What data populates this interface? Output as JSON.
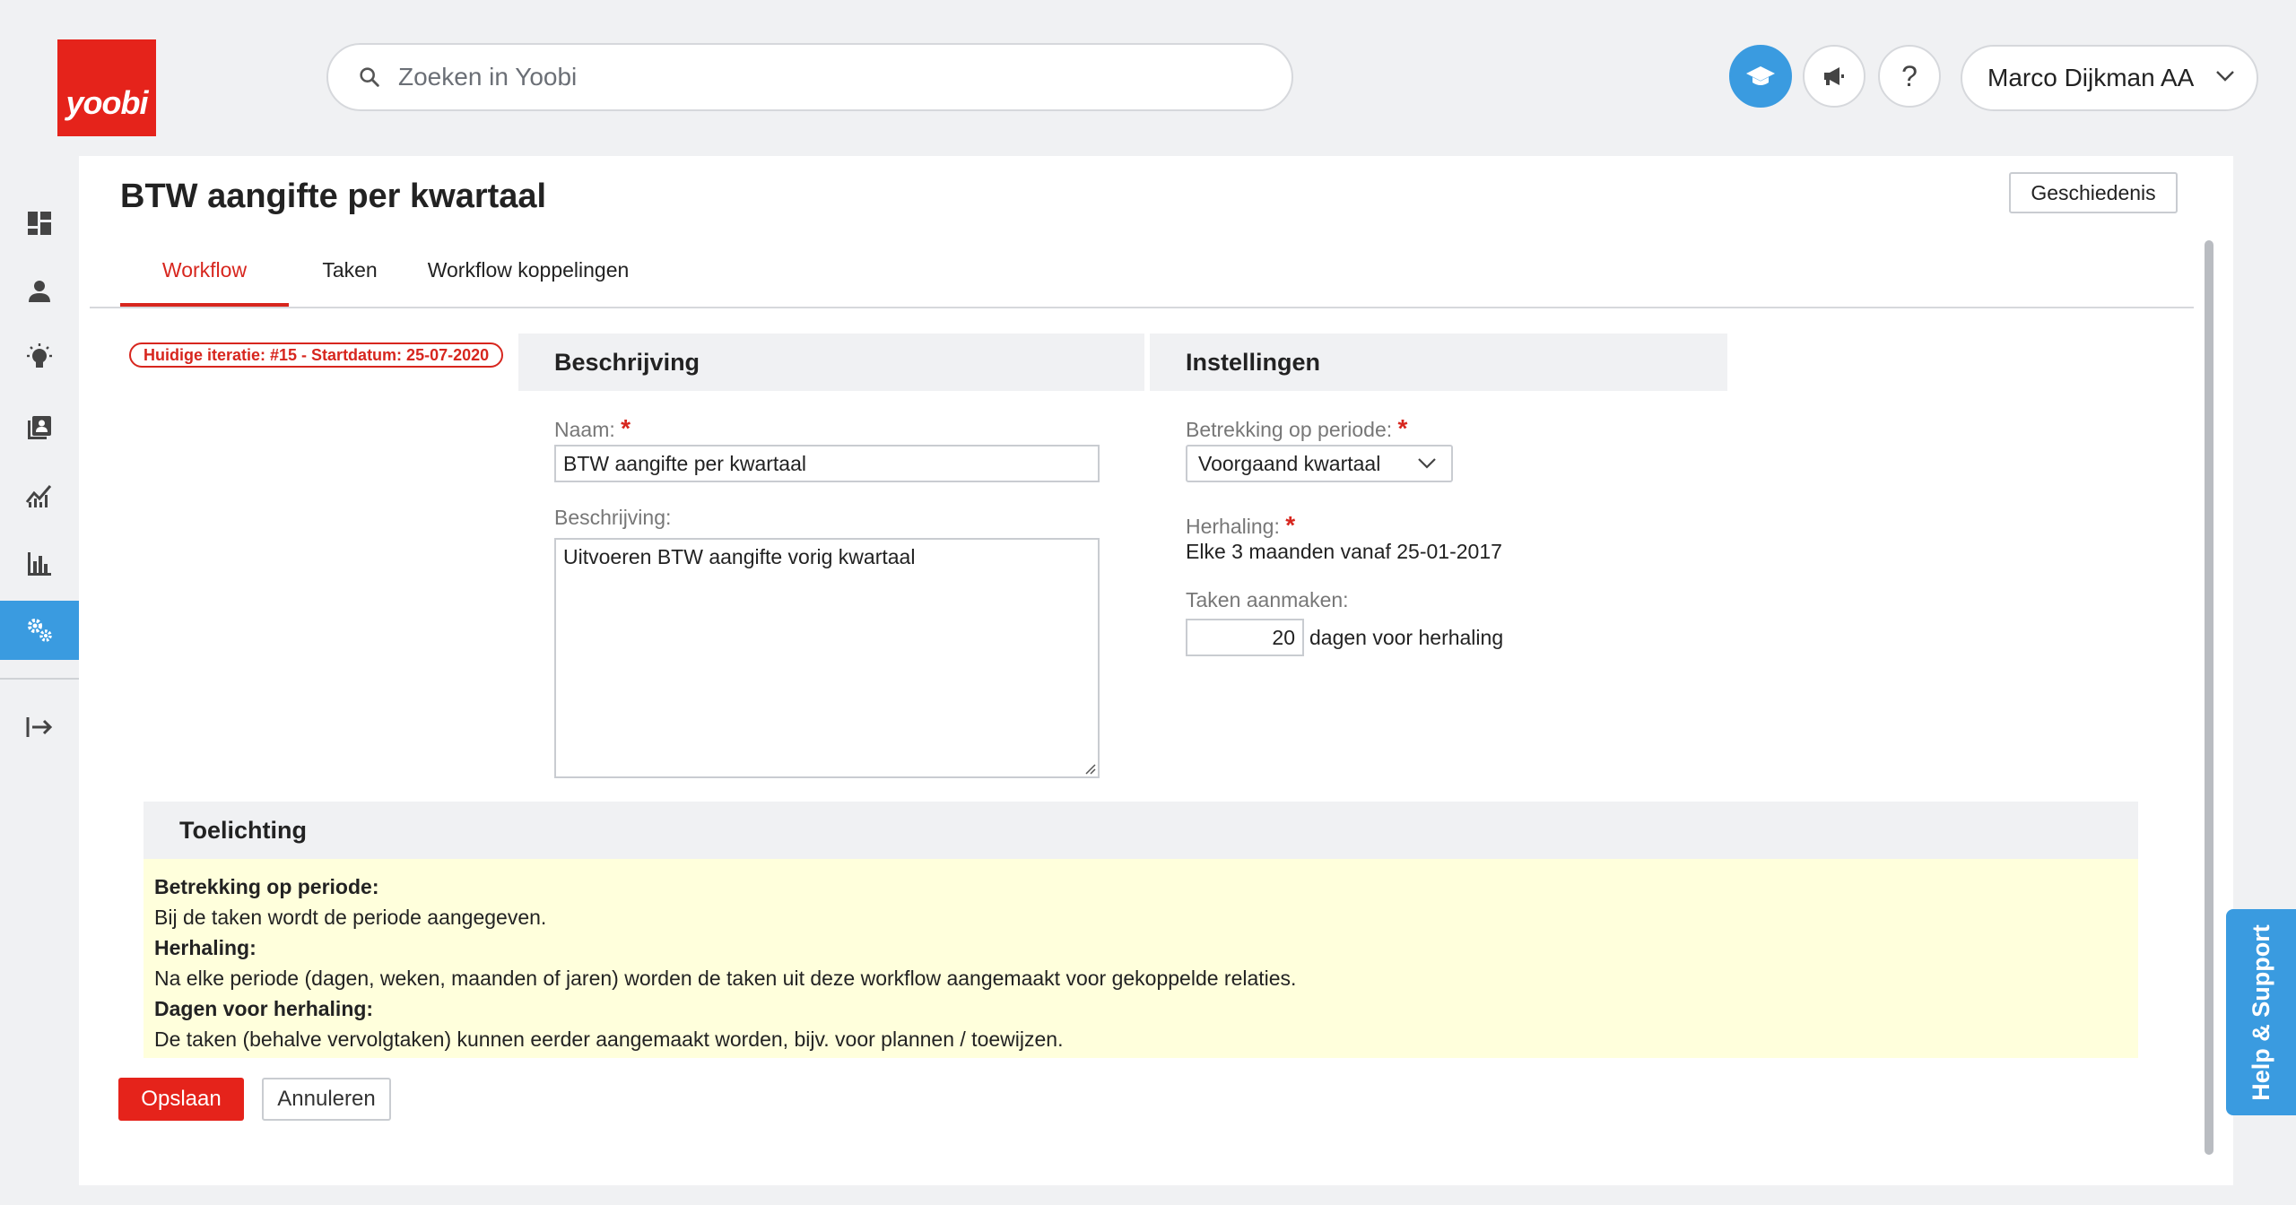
{
  "logo": {
    "text": "yoobi"
  },
  "search": {
    "placeholder": "Zoeken in Yoobi"
  },
  "header": {
    "user_name": "Marco Dijkman AA",
    "help_symbol": "?"
  },
  "sidebar": {
    "items": [
      {
        "icon": "dashboard-icon"
      },
      {
        "icon": "person-icon"
      },
      {
        "icon": "lightbulb-icon"
      },
      {
        "icon": "contacts-book-icon"
      },
      {
        "icon": "trending-chart-icon"
      },
      {
        "icon": "bar-chart-icon"
      },
      {
        "icon": "settings-gears-icon",
        "active": true
      },
      {
        "icon": "logout-arrow-icon"
      }
    ]
  },
  "page": {
    "title": "BTW aangifte per kwartaal",
    "history_button": "Geschiedenis",
    "tabs": [
      {
        "label": "Workflow",
        "active": true
      },
      {
        "label": "Taken"
      },
      {
        "label": "Workflow koppelingen"
      }
    ],
    "iteration_badge": "Huidige iteratie: #15 - Startdatum: 25-07-2020"
  },
  "description_section": {
    "title": "Beschrijving",
    "name_label": "Naam:",
    "name_value": "BTW aangifte per kwartaal",
    "desc_label": "Beschrijving:",
    "desc_value": "Uitvoeren BTW aangifte vorig kwartaal",
    "required_mark": "*"
  },
  "settings_section": {
    "title": "Instellingen",
    "period_label": "Betrekking op periode:",
    "period_value": "Voorgaand kwartaal",
    "repeat_label": "Herhaling:",
    "repeat_value": "Elke 3 maanden vanaf 25-01-2017",
    "create_label": "Taken aanmaken:",
    "create_days": "20",
    "create_suffix": "dagen voor herhaling",
    "required_mark": "*"
  },
  "explanation": {
    "title": "Toelichting",
    "items": [
      {
        "heading": "Betrekking op periode:",
        "text": "Bij de taken wordt de periode aangegeven."
      },
      {
        "heading": "Herhaling:",
        "text": "Na elke periode (dagen, weken, maanden of jaren) worden de taken uit deze workflow aangemaakt voor gekoppelde relaties."
      },
      {
        "heading": "Dagen voor herhaling:",
        "text": "De taken (behalve vervolgtaken) kunnen eerder aangemaakt worden, bijv. voor plannen / toewijzen."
      }
    ]
  },
  "actions": {
    "save": "Opslaan",
    "cancel": "Annuleren"
  },
  "help_tab": {
    "label": "Help & Support"
  },
  "colors": {
    "brand_red": "#e5231b",
    "accent_blue": "#3a9be0",
    "note_yellow": "#ffffdc"
  }
}
